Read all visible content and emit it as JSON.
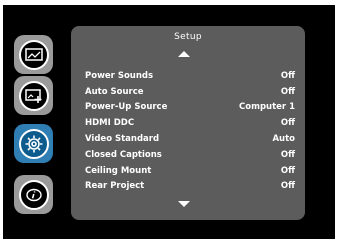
{
  "menu": {
    "title": "Setup",
    "items": [
      {
        "label": "Power Sounds",
        "value": "Off"
      },
      {
        "label": "Auto Source",
        "value": "Off"
      },
      {
        "label": "Power-Up Source",
        "value": "Computer 1"
      },
      {
        "label": "HDMI DDC",
        "value": "Off"
      },
      {
        "label": "Video Standard",
        "value": "Auto"
      },
      {
        "label": "Closed Captions",
        "value": "Off"
      },
      {
        "label": "Ceiling Mount",
        "value": "Off"
      },
      {
        "label": "Rear Project",
        "value": "Off"
      }
    ]
  },
  "sidebar": {
    "buttons": [
      {
        "icon": "picture-icon",
        "active": false
      },
      {
        "icon": "advanced-picture-icon",
        "active": false
      },
      {
        "icon": "settings-gear-icon",
        "active": true
      },
      {
        "icon": "info-icon",
        "active": false
      }
    ]
  },
  "colors": {
    "panel": "#5c5c5c",
    "active_accent": "#2f7fb4",
    "inactive_button": "#9a9a9a"
  }
}
